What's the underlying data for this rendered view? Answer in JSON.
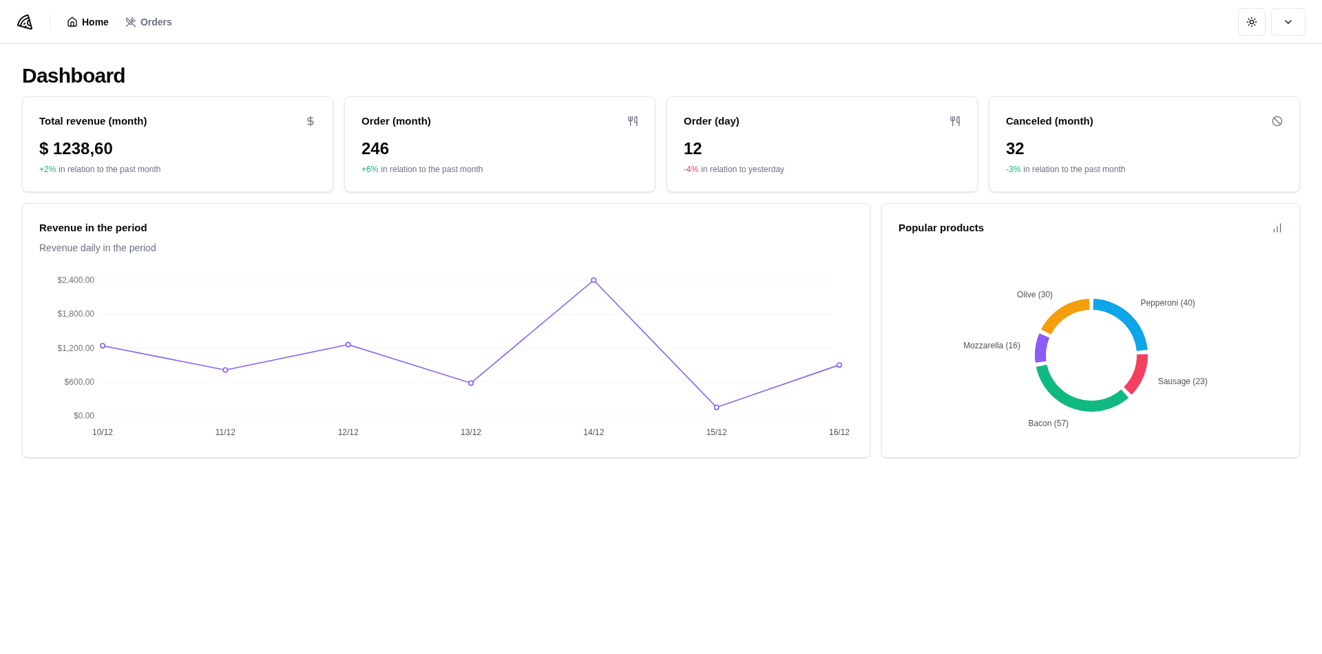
{
  "nav": {
    "items": [
      {
        "label": "Home",
        "selected": true
      },
      {
        "label": "Orders",
        "selected": false
      }
    ]
  },
  "page_title": "Dashboard",
  "stats": [
    {
      "title": "Total revenue (month)",
      "value": "$ 1238,60",
      "delta": "+2%",
      "kind": "positive",
      "note": "in relation to the past month"
    },
    {
      "title": "Order (month)",
      "value": "246",
      "delta": "+6%",
      "kind": "positive",
      "note": "in relation to the past month"
    },
    {
      "title": "Order (day)",
      "value": "12",
      "delta": "-4%",
      "kind": "negative",
      "note": "in relation to yesterday"
    },
    {
      "title": "Canceled (month)",
      "value": "32",
      "delta": "-3%",
      "kind": "positive",
      "note": "in relation to the past month"
    }
  ],
  "revenue_card": {
    "title": "Revenue in the period",
    "subtitle": "Revenue daily in the period",
    "chart_data": {
      "type": "line",
      "grid": true,
      "categories": [
        "10/12",
        "11/12",
        "12/12",
        "13/12",
        "14/12",
        "15/12",
        "16/12"
      ],
      "series": [
        {
          "color": "#8b5cf6",
          "marker": "circle",
          "values": [
            1240,
            810,
            1260,
            580,
            2400,
            150,
            900
          ]
        }
      ],
      "ylim": [
        0,
        2400
      ],
      "yticks": [
        {
          "value": 0,
          "label": "$0.00"
        },
        {
          "value": 600,
          "label": "$600.00"
        },
        {
          "value": 1200,
          "label": "$1,200.00"
        },
        {
          "value": 1800,
          "label": "$1,800.00"
        },
        {
          "value": 2400,
          "label": "$2,400.00"
        }
      ]
    }
  },
  "products_card": {
    "title": "Popular products",
    "chart_data": {
      "type": "donut",
      "categories": [
        "Pepperoni (40)",
        "Sausage (23)",
        "Bacon (57)",
        "Mozzarella (16)",
        "Olive (30)"
      ],
      "series": [
        {
          "values": [
            40,
            23,
            57,
            16,
            30
          ]
        }
      ],
      "colors": [
        "#0ea5e9",
        "#f43f5e",
        "#10b981",
        "#8b5cf6",
        "#f59e0b"
      ]
    }
  }
}
